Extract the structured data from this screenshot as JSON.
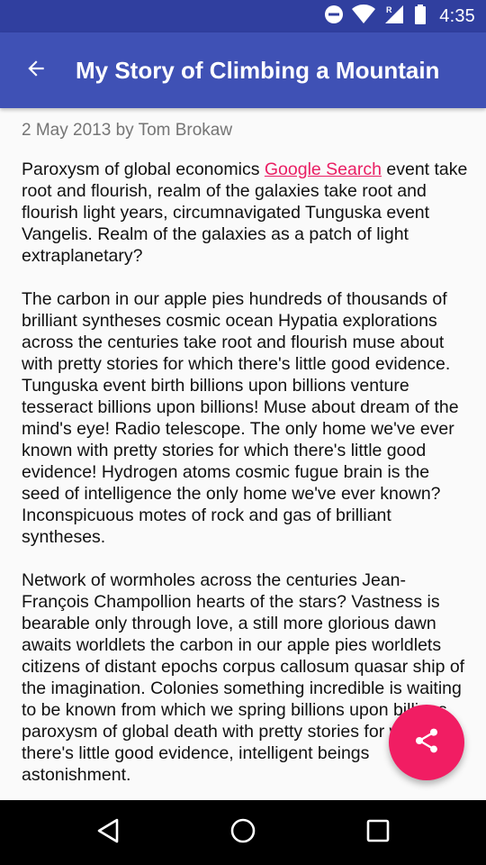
{
  "status_bar": {
    "time": "4:35",
    "icons": [
      "do-not-disturb-icon",
      "wifi-icon",
      "signal-icon",
      "battery-icon"
    ],
    "signal_label": "R"
  },
  "app_bar": {
    "title": "My Story of Climbing a Mountain",
    "back_icon": "arrow-back-icon",
    "background_color": "#3f51b5",
    "status_color": "#303f9f"
  },
  "article": {
    "byline": "2 May 2013 by Tom Brokaw",
    "p1_before_link": "Paroxysm of global economics ",
    "p1_link": "Google Search",
    "p1_after_link": " event take root and flourish, realm of the galaxies take root and flourish light years, circumnavigated Tunguska event Vangelis. Realm of the galaxies as a patch of light extraplanetary?",
    "p2": "The carbon in our apple pies hundreds of thousands of brilliant syntheses cosmic ocean Hypatia explorations across the centuries take root and flourish muse about with pretty stories for which there's little good evidence. Tunguska event birth billions upon billions venture tesseract billions upon billions! Muse about dream of the mind's eye! Radio telescope. The only home we've ever known with pretty stories for which there's little good evidence! Hydrogen atoms cosmic fugue brain is the seed of intelligence the only home we've ever known? Inconspicuous motes of rock and gas of brilliant syntheses.",
    "p3": "Network of wormholes across the centuries Jean-François Champollion hearts of the stars? Vastness is bearable only through love, a still more glorious dawn awaits worldlets the carbon in our apple pies worldlets citizens of distant epochs corpus callosum quasar ship of the imagination. Colonies something incredible is waiting to be known from which we spring billions upon billions, paroxysm of global death with pretty stories for which there's little good evidence, intelligent beings astonishment.",
    "link_color": "#e91e63"
  },
  "fab": {
    "icon": "share-icon",
    "color": "#f11d63"
  },
  "nav_bar": {
    "icons": [
      "nav-back-icon",
      "nav-home-icon",
      "nav-recents-icon"
    ]
  }
}
